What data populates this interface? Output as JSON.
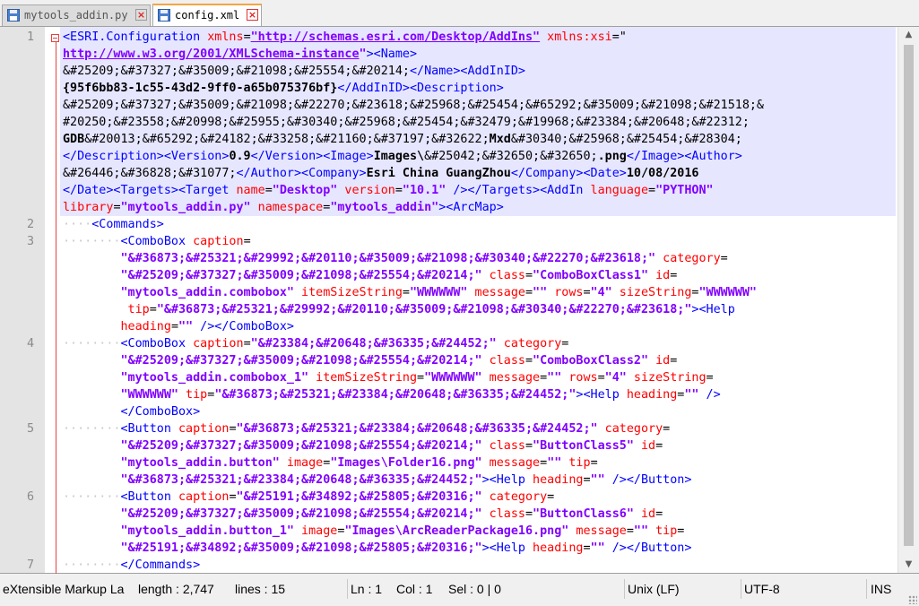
{
  "tabs": [
    {
      "label": "mytools_addin.py",
      "active": false
    },
    {
      "label": "config.xml",
      "active": true
    }
  ],
  "editor": {
    "line_numbers": [
      "1",
      "2",
      "3",
      "4",
      "5",
      "6",
      "7"
    ],
    "rows": [
      {
        "ln": "1",
        "ind": "",
        "tok": [
          [
            "t",
            "<ESRI.Configuration "
          ],
          [
            "a",
            "xmlns"
          ],
          [
            "x",
            "="
          ],
          [
            "u",
            "\"http://schemas.esri.com/Desktop/AddIns\""
          ],
          [
            "a",
            " xmlns:xsi"
          ],
          [
            "x",
            "=\""
          ]
        ]
      },
      {
        "ln": "",
        "ind": "",
        "tok": [
          [
            "u",
            "http://www.w3.org/2001/XMLSchema-instance"
          ],
          [
            "v",
            "\""
          ],
          [
            "t",
            "><Name>"
          ]
        ]
      },
      {
        "ln": "",
        "ind": "",
        "tok": [
          [
            "x",
            "&#25209;&#37327;&#35009;&#21098;&#25554;&#20214;"
          ],
          [
            "t",
            "</Name><AddInID>"
          ]
        ]
      },
      {
        "ln": "",
        "ind": "",
        "tok": [
          [
            "b",
            "{95f6bb83-1c55-43d2-9ff0-a65b075376bf}"
          ],
          [
            "t",
            "</AddInID><Description>"
          ]
        ]
      },
      {
        "ln": "",
        "ind": "",
        "tok": [
          [
            "x",
            "&#25209;&#37327;&#35009;&#21098;&#22270;&#23618;&#25968;&#25454;&#65292;&#35009;&#21098;&#21518;&"
          ]
        ]
      },
      {
        "ln": "",
        "ind": "",
        "tok": [
          [
            "x",
            "#20250;&#23558;&#20998;&#25955;&#30340;&#25968;&#25454;&#32479;&#19968;&#23384;&#20648;&#22312;"
          ]
        ]
      },
      {
        "ln": "",
        "ind": "",
        "tok": [
          [
            "b",
            "GDB"
          ],
          [
            "x",
            "&#20013;&#65292;&#24182;&#33258;&#21160;&#37197;&#32622;"
          ],
          [
            "b",
            "Mxd"
          ],
          [
            "x",
            "&#30340;&#25968;&#25454;&#28304;"
          ]
        ]
      },
      {
        "ln": "",
        "ind": "",
        "tok": [
          [
            "t",
            "</Description><Version>"
          ],
          [
            "b",
            "0.9"
          ],
          [
            "t",
            "</Version><Image>"
          ],
          [
            "b",
            "Images\\"
          ],
          [
            "x",
            "&#25042;&#32650;&#32650;"
          ],
          [
            "b",
            ".png"
          ],
          [
            "t",
            "</Image><Author>"
          ]
        ]
      },
      {
        "ln": "",
        "ind": "",
        "tok": [
          [
            "x",
            "&#26446;&#36828;&#31077;"
          ],
          [
            "t",
            "</Author><Company>"
          ],
          [
            "b",
            "Esri China GuangZhou"
          ],
          [
            "t",
            "</Company><Date>"
          ],
          [
            "b",
            "10/08/2016"
          ]
        ]
      },
      {
        "ln": "",
        "ind": "",
        "tok": [
          [
            "t",
            "</Date><Targets><Target "
          ],
          [
            "a",
            "name"
          ],
          [
            "x",
            "="
          ],
          [
            "v",
            "\"Desktop\""
          ],
          [
            "a",
            " version"
          ],
          [
            "x",
            "="
          ],
          [
            "v",
            "\"10.1\""
          ],
          [
            "t",
            " /></Targets><AddIn "
          ],
          [
            "a",
            "language"
          ],
          [
            "x",
            "="
          ],
          [
            "v",
            "\"PYTHON\""
          ]
        ]
      },
      {
        "ln": "",
        "ind": "",
        "tok": [
          [
            "a",
            "library"
          ],
          [
            "x",
            "="
          ],
          [
            "v",
            "\"mytools_addin.py\""
          ],
          [
            "a",
            " namespace"
          ],
          [
            "x",
            "="
          ],
          [
            "v",
            "\"mytools_addin\""
          ],
          [
            "t",
            "><ArcMap>"
          ]
        ]
      },
      {
        "ln": "2",
        "ind": "····",
        "tok": [
          [
            "t",
            "<Commands>"
          ]
        ]
      },
      {
        "ln": "3",
        "ind": "········",
        "tok": [
          [
            "t",
            "<ComboBox "
          ],
          [
            "a",
            "caption"
          ],
          [
            "x",
            "="
          ]
        ]
      },
      {
        "ln": "",
        "ind": "",
        "pad": "        ",
        "tok": [
          [
            "v",
            "\"&#36873;&#25321;&#29992;&#20110;&#35009;&#21098;&#30340;&#22270;&#23618;\""
          ],
          [
            "a",
            " category"
          ],
          [
            "x",
            "="
          ]
        ]
      },
      {
        "ln": "",
        "ind": "",
        "pad": "        ",
        "tok": [
          [
            "v",
            "\"&#25209;&#37327;&#35009;&#21098;&#25554;&#20214;\""
          ],
          [
            "a",
            " class"
          ],
          [
            "x",
            "="
          ],
          [
            "v",
            "\"ComboBoxClass1\""
          ],
          [
            "a",
            " id"
          ],
          [
            "x",
            "="
          ]
        ]
      },
      {
        "ln": "",
        "ind": "",
        "pad": "        ",
        "tok": [
          [
            "v",
            "\"mytools_addin.combobox\""
          ],
          [
            "a",
            " itemSizeString"
          ],
          [
            "x",
            "="
          ],
          [
            "v",
            "\"WWWWWW\""
          ],
          [
            "a",
            " message"
          ],
          [
            "x",
            "="
          ],
          [
            "v",
            "\"\""
          ],
          [
            "a",
            " rows"
          ],
          [
            "x",
            "="
          ],
          [
            "v",
            "\"4\""
          ],
          [
            "a",
            " sizeString"
          ],
          [
            "x",
            "="
          ],
          [
            "v",
            "\"WWWWWW\""
          ]
        ]
      },
      {
        "ln": "",
        "ind": "",
        "pad": "        ",
        "tok": [
          [
            "a",
            " tip"
          ],
          [
            "x",
            "="
          ],
          [
            "v",
            "\"&#36873;&#25321;&#29992;&#20110;&#35009;&#21098;&#30340;&#22270;&#23618;\""
          ],
          [
            "t",
            "><Help"
          ]
        ]
      },
      {
        "ln": "",
        "ind": "",
        "pad": "        ",
        "tok": [
          [
            "a",
            "heading"
          ],
          [
            "x",
            "="
          ],
          [
            "v",
            "\"\""
          ],
          [
            "t",
            " /></ComboBox>"
          ]
        ]
      },
      {
        "ln": "4",
        "ind": "········",
        "tok": [
          [
            "t",
            "<ComboBox "
          ],
          [
            "a",
            "caption"
          ],
          [
            "x",
            "="
          ],
          [
            "v",
            "\"&#23384;&#20648;&#36335;&#24452;\""
          ],
          [
            "a",
            " category"
          ],
          [
            "x",
            "="
          ]
        ]
      },
      {
        "ln": "",
        "ind": "",
        "pad": "        ",
        "tok": [
          [
            "v",
            "\"&#25209;&#37327;&#35009;&#21098;&#25554;&#20214;\""
          ],
          [
            "a",
            " class"
          ],
          [
            "x",
            "="
          ],
          [
            "v",
            "\"ComboBoxClass2\""
          ],
          [
            "a",
            " id"
          ],
          [
            "x",
            "="
          ]
        ]
      },
      {
        "ln": "",
        "ind": "",
        "pad": "        ",
        "tok": [
          [
            "v",
            "\"mytools_addin.combobox_1\""
          ],
          [
            "a",
            " itemSizeString"
          ],
          [
            "x",
            "="
          ],
          [
            "v",
            "\"WWWWWW\""
          ],
          [
            "a",
            " message"
          ],
          [
            "x",
            "="
          ],
          [
            "v",
            "\"\""
          ],
          [
            "a",
            " rows"
          ],
          [
            "x",
            "="
          ],
          [
            "v",
            "\"4\""
          ],
          [
            "a",
            " sizeString"
          ],
          [
            "x",
            "="
          ]
        ]
      },
      {
        "ln": "",
        "ind": "",
        "pad": "        ",
        "tok": [
          [
            "v",
            "\"WWWWWW\""
          ],
          [
            "a",
            " tip"
          ],
          [
            "x",
            "="
          ],
          [
            "v",
            "\"&#36873;&#25321;&#23384;&#20648;&#36335;&#24452;\""
          ],
          [
            "t",
            "><Help "
          ],
          [
            "a",
            "heading"
          ],
          [
            "x",
            "="
          ],
          [
            "v",
            "\"\""
          ],
          [
            "t",
            " />"
          ]
        ]
      },
      {
        "ln": "",
        "ind": "",
        "pad": "        ",
        "tok": [
          [
            "t",
            "</ComboBox>"
          ]
        ]
      },
      {
        "ln": "5",
        "ind": "········",
        "tok": [
          [
            "t",
            "<Button "
          ],
          [
            "a",
            "caption"
          ],
          [
            "x",
            "="
          ],
          [
            "v",
            "\"&#36873;&#25321;&#23384;&#20648;&#36335;&#24452;\""
          ],
          [
            "a",
            " category"
          ],
          [
            "x",
            "="
          ]
        ]
      },
      {
        "ln": "",
        "ind": "",
        "pad": "        ",
        "tok": [
          [
            "v",
            "\"&#25209;&#37327;&#35009;&#21098;&#25554;&#20214;\""
          ],
          [
            "a",
            " class"
          ],
          [
            "x",
            "="
          ],
          [
            "v",
            "\"ButtonClass5\""
          ],
          [
            "a",
            " id"
          ],
          [
            "x",
            "="
          ]
        ]
      },
      {
        "ln": "",
        "ind": "",
        "pad": "        ",
        "tok": [
          [
            "v",
            "\"mytools_addin.button\""
          ],
          [
            "a",
            " image"
          ],
          [
            "x",
            "="
          ],
          [
            "v",
            "\"Images\\Folder16.png\""
          ],
          [
            "a",
            " message"
          ],
          [
            "x",
            "="
          ],
          [
            "v",
            "\"\""
          ],
          [
            "a",
            " tip"
          ],
          [
            "x",
            "="
          ]
        ]
      },
      {
        "ln": "",
        "ind": "",
        "pad": "        ",
        "tok": [
          [
            "v",
            "\"&#36873;&#25321;&#23384;&#20648;&#36335;&#24452;\""
          ],
          [
            "t",
            "><Help "
          ],
          [
            "a",
            "heading"
          ],
          [
            "x",
            "="
          ],
          [
            "v",
            "\"\""
          ],
          [
            "t",
            " /></Button>"
          ]
        ]
      },
      {
        "ln": "6",
        "ind": "········",
        "tok": [
          [
            "t",
            "<Button "
          ],
          [
            "a",
            "caption"
          ],
          [
            "x",
            "="
          ],
          [
            "v",
            "\"&#25191;&#34892;&#25805;&#20316;\""
          ],
          [
            "a",
            " category"
          ],
          [
            "x",
            "="
          ]
        ]
      },
      {
        "ln": "",
        "ind": "",
        "pad": "        ",
        "tok": [
          [
            "v",
            "\"&#25209;&#37327;&#35009;&#21098;&#25554;&#20214;\""
          ],
          [
            "a",
            " class"
          ],
          [
            "x",
            "="
          ],
          [
            "v",
            "\"ButtonClass6\""
          ],
          [
            "a",
            " id"
          ],
          [
            "x",
            "="
          ]
        ]
      },
      {
        "ln": "",
        "ind": "",
        "pad": "        ",
        "tok": [
          [
            "v",
            "\"mytools_addin.button_1\""
          ],
          [
            "a",
            " image"
          ],
          [
            "x",
            "="
          ],
          [
            "v",
            "\"Images\\ArcReaderPackage16.png\""
          ],
          [
            "a",
            " message"
          ],
          [
            "x",
            "="
          ],
          [
            "v",
            "\"\""
          ],
          [
            "a",
            " tip"
          ],
          [
            "x",
            "="
          ]
        ]
      },
      {
        "ln": "",
        "ind": "",
        "pad": "        ",
        "tok": [
          [
            "v",
            "\"&#25191;&#34892;&#35009;&#21098;&#25805;&#20316;\""
          ],
          [
            "t",
            "><Help "
          ],
          [
            "a",
            "heading"
          ],
          [
            "x",
            "="
          ],
          [
            "v",
            "\"\""
          ],
          [
            "t",
            " /></Button>"
          ]
        ]
      },
      {
        "ln": "7",
        "ind": "········",
        "tok": [
          [
            "t",
            "</Commands>"
          ]
        ]
      }
    ]
  },
  "status": {
    "language": "eXtensible Markup La",
    "length": "length : 2,747",
    "lines": "lines : 15",
    "ln": "Ln : 1",
    "col": "Col : 1",
    "sel": "Sel : 0 | 0",
    "eol": "Unix (LF)",
    "encoding": "UTF-8",
    "mode": "INS"
  },
  "colors": {
    "tag": "#0000ff",
    "attribute": "#ff0000",
    "value": "#8000ff",
    "current_line": "#e6e6ff",
    "fold_marker": "#e64242"
  },
  "icons": {
    "file": "save-disk-icon",
    "close": "close-x-icon",
    "fold": "fold-minus-icon",
    "scroll_up": "scroll-up-arrow-icon",
    "scroll_down": "scroll-down-arrow-icon"
  }
}
